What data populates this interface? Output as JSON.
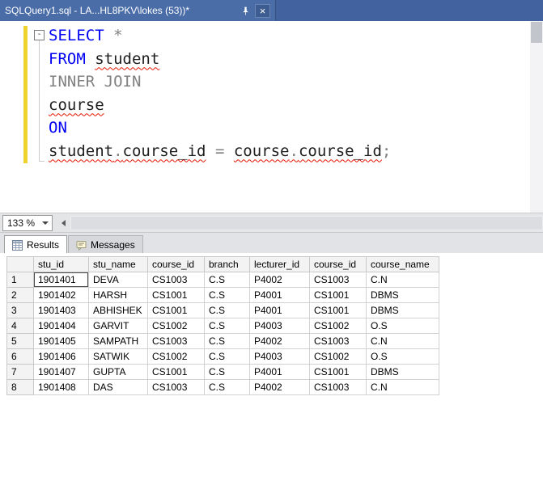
{
  "window": {
    "title_tab": "SQLQuery1.sql - LA...HL8PKV\\lokes (53))*",
    "close_glyph": "×"
  },
  "editor": {
    "collapse_glyph": "-",
    "lines": [
      {
        "tokens": [
          {
            "text": "SELECT",
            "type": "keyword"
          },
          {
            "text": " ",
            "type": "plain"
          },
          {
            "text": "*",
            "type": "operator"
          }
        ]
      },
      {
        "tokens": [
          {
            "text": "FROM",
            "type": "keyword"
          },
          {
            "text": " ",
            "type": "plain"
          },
          {
            "text": "student",
            "type": "error"
          }
        ]
      },
      {
        "tokens": [
          {
            "text": "INNER JOIN",
            "type": "operator"
          }
        ]
      },
      {
        "tokens": [
          {
            "text": "course",
            "type": "error"
          }
        ]
      },
      {
        "tokens": [
          {
            "text": "ON",
            "type": "keyword"
          }
        ]
      },
      {
        "tokens": [
          {
            "text": "student",
            "type": "error"
          },
          {
            "text": ".",
            "type": "error_op"
          },
          {
            "text": "course_id",
            "type": "error"
          },
          {
            "text": " ",
            "type": "plain"
          },
          {
            "text": "=",
            "type": "operator"
          },
          {
            "text": " ",
            "type": "plain"
          },
          {
            "text": "course",
            "type": "error"
          },
          {
            "text": ".",
            "type": "error_op"
          },
          {
            "text": "course_id",
            "type": "error"
          },
          {
            "text": ";",
            "type": "operator"
          }
        ]
      }
    ]
  },
  "statusbar": {
    "zoom": "133 %"
  },
  "panel_tabs": {
    "results": "Results",
    "messages": "Messages"
  },
  "grid": {
    "columns": [
      "stu_id",
      "stu_name",
      "course_id",
      "branch",
      "lecturer_id",
      "course_id",
      "course_name"
    ],
    "rows": [
      {
        "n": "1",
        "cells": [
          "1901401",
          "DEVA",
          "CS1003",
          "C.S",
          "P4002",
          "CS1003",
          "C.N"
        ]
      },
      {
        "n": "2",
        "cells": [
          "1901402",
          "HARSH",
          "CS1001",
          "C.S",
          "P4001",
          "CS1001",
          "DBMS"
        ]
      },
      {
        "n": "3",
        "cells": [
          "1901403",
          "ABHISHEK",
          "CS1001",
          "C.S",
          "P4001",
          "CS1001",
          "DBMS"
        ]
      },
      {
        "n": "4",
        "cells": [
          "1901404",
          "GARVIT",
          "CS1002",
          "C.S",
          "P4003",
          "CS1002",
          "O.S"
        ]
      },
      {
        "n": "5",
        "cells": [
          "1901405",
          "SAMPATH",
          "CS1003",
          "C.S",
          "P4002",
          "CS1003",
          "C.N"
        ]
      },
      {
        "n": "6",
        "cells": [
          "1901406",
          "SATWIK",
          "CS1002",
          "C.S",
          "P4003",
          "CS1002",
          "O.S"
        ]
      },
      {
        "n": "7",
        "cells": [
          "1901407",
          "GUPTA",
          "CS1001",
          "C.S",
          "P4001",
          "CS1001",
          "DBMS"
        ]
      },
      {
        "n": "8",
        "cells": [
          "1901408",
          "DAS",
          "CS1003",
          "C.S",
          "P4002",
          "CS1003",
          "C.N"
        ]
      }
    ],
    "selected_cell": {
      "row": 0,
      "col": 0
    }
  },
  "icons": {
    "pin": "pushpin",
    "close": "close-x",
    "results_tab": "grid-table",
    "messages_tab": "message-note",
    "zoom": "chevron-down",
    "scroll_left": "triangle-left"
  },
  "colors": {
    "tabstrip": "#41629e",
    "active_tab": "#4a6da8",
    "keyword_blue": "#0000f5",
    "operator_gray": "#808080",
    "error_underline": "#e51400",
    "change_bar_yellow": "#efd32d"
  }
}
